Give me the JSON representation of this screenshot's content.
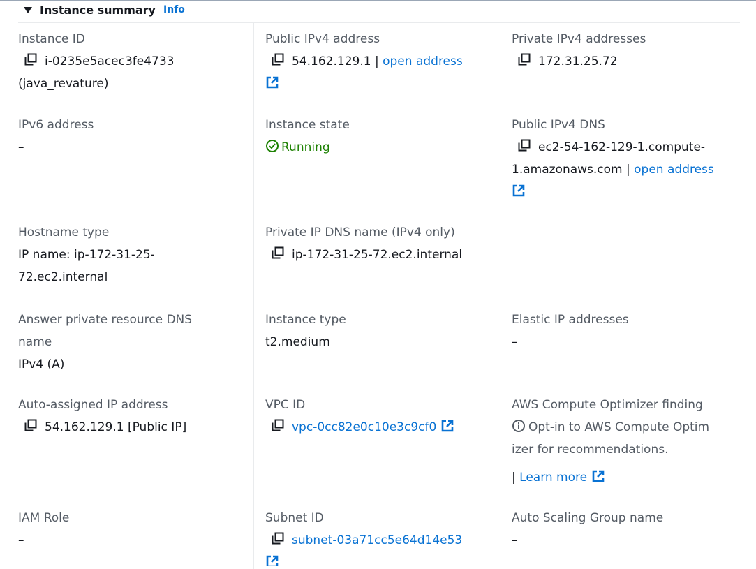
{
  "section": {
    "title": "Instance summary",
    "info_label": "Info"
  },
  "fields": {
    "instance_id": {
      "label": "Instance ID",
      "value": "i-0235e5acec3fe4733",
      "subvalue": "(java_revature)"
    },
    "public_ipv4": {
      "label": "Public IPv4 address",
      "value": "54.162.129.1",
      "separator": "|",
      "link": "open address"
    },
    "private_ipv4": {
      "label": "Private IPv4 addresses",
      "value": "172.31.25.72"
    },
    "ipv6": {
      "label": "IPv6 address",
      "value": "–"
    },
    "instance_state": {
      "label": "Instance state",
      "value": "Running"
    },
    "public_dns": {
      "label": "Public IPv4 DNS",
      "value_line1": "ec2-54-162-129-1.compute-",
      "value_line2": "1.amazonaws.com",
      "separator": "|",
      "link": "open address"
    },
    "hostname_type": {
      "label": "Hostname type",
      "value_line1": "IP name: ip-172-31-25-",
      "value_line2": "72.ec2.internal"
    },
    "private_dns": {
      "label": "Private IP DNS name (IPv4 only)",
      "value": "ip-172-31-25-72.ec2.internal"
    },
    "answer_dns": {
      "label_line1": "Answer private resource DNS",
      "label_line2": "name",
      "value": "IPv4 (A)"
    },
    "instance_type": {
      "label": "Instance type",
      "value": "t2.medium"
    },
    "elastic_ip": {
      "label": "Elastic IP addresses",
      "value": "–"
    },
    "auto_ip": {
      "label": "Auto-assigned IP address",
      "value": "54.162.129.1 [Public IP]"
    },
    "vpc_id": {
      "label": "VPC ID",
      "value": "vpc-0cc82e0c10e3c9cf0"
    },
    "optimizer": {
      "label": "AWS Compute Optimizer finding",
      "text_line1": "Opt-in to AWS Compute Optim",
      "text_line2": "izer for recommendations.",
      "separator": "|",
      "link": "Learn more"
    },
    "iam_role": {
      "label": "IAM Role",
      "value": "–"
    },
    "subnet_id": {
      "label": "Subnet ID",
      "value": "subnet-03a71cc5e64d14e53"
    },
    "asg_name": {
      "label": "Auto Scaling Group name",
      "value": "–"
    }
  },
  "colors": {
    "link": "#0972d3",
    "label": "#545b64",
    "value": "#16191f",
    "running": "#1d8102",
    "divider": "#e9ebed"
  },
  "icons": [
    "copy-icon",
    "external-link-icon",
    "status-running-icon",
    "info-circle-icon",
    "caret-down-icon"
  ]
}
